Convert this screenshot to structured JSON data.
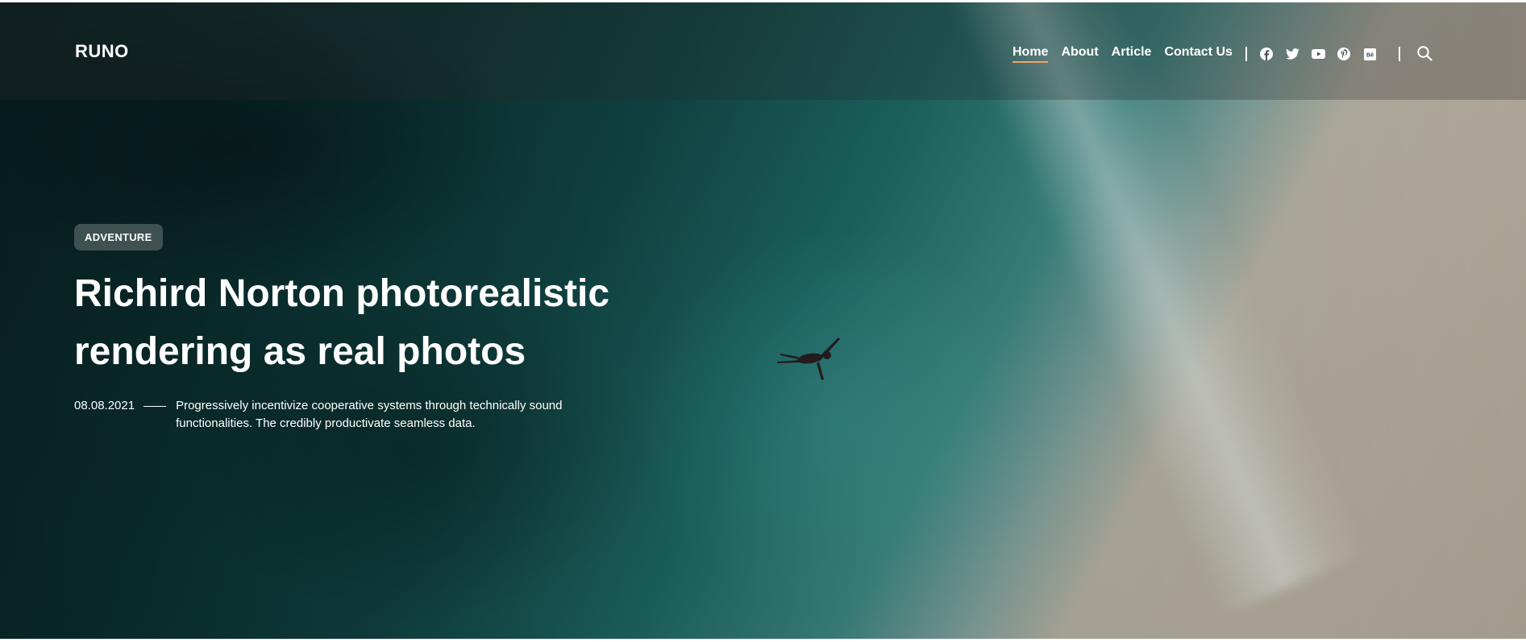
{
  "header": {
    "logo": "RUNO",
    "nav": [
      {
        "label": "Home",
        "active": true
      },
      {
        "label": "About",
        "active": false
      },
      {
        "label": "Article",
        "active": false
      },
      {
        "label": "Contact Us",
        "active": false
      }
    ],
    "social_icons": [
      "facebook-icon",
      "twitter-icon",
      "youtube-icon",
      "pinterest-icon",
      "behance-icon"
    ],
    "search_icon": "search-icon"
  },
  "hero": {
    "category": "ADVENTURE",
    "title": "Richird Norton photorealistic rendering as real photos",
    "date": "08.08.2021",
    "description": "Progressively incentivize cooperative systems through technically sound functionalities. The credibly productivate seamless data."
  },
  "colors": {
    "accent_underline": "#f0a36b",
    "ocean_deep": "#0e3a3a",
    "ocean_shallow": "#2f7d78",
    "sand": "#b5ad9e"
  }
}
